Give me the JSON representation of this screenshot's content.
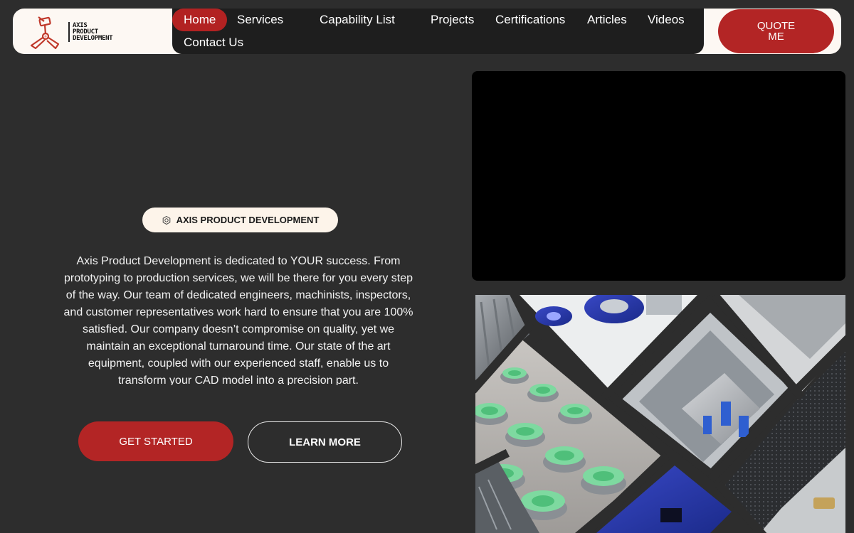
{
  "brand": {
    "name_line1": "AXIS",
    "name_line2": "PRODUCT",
    "name_line3": "DEVELOPMENT",
    "accent_color": "#b32525"
  },
  "nav": {
    "items": [
      {
        "label": "Home",
        "active": true
      },
      {
        "label": "Services"
      },
      {
        "label": "Capability List"
      },
      {
        "label": "Projects"
      },
      {
        "label": "Certifications"
      },
      {
        "label": "Articles"
      },
      {
        "label": "Videos"
      },
      {
        "label": "Contact Us"
      }
    ]
  },
  "quote_button": {
    "label": "QUOTE ME"
  },
  "hero": {
    "badge_icon": "gear-icon",
    "badge_label": "AXIS PRODUCT DEVELOPMENT",
    "description": "Axis Product Development is dedicated to YOUR success. From prototyping to production services, we will be there for you every step of the way. Our team of dedicated engineers, machinists, inspectors, and customer representatives work hard to ensure that you are 100% satisfied. Our company doesn’t compromise on quality, yet we maintain an exceptional turnaround time. Our state of the art equipment, coupled with our experienced staff, enable us to transform your CAD model into a precision part.",
    "primary_button": "GET STARTED",
    "secondary_button": "LEARN MORE"
  }
}
